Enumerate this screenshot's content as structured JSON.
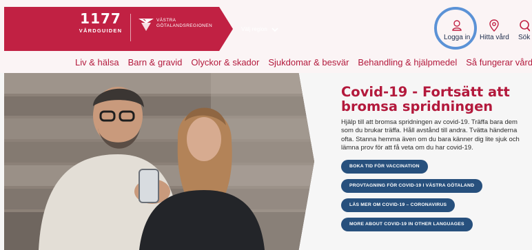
{
  "header": {
    "logo_number": "1177",
    "logo_subtitle": "VÅRDGUIDEN",
    "region_logo_line1": "VÄSTRA",
    "region_logo_line2": "GÖTALANDSREGIONEN",
    "region_select_label": "Välj region",
    "utility": {
      "login_label": "Logga in",
      "find_care_label": "Hitta vård",
      "search_label": "Sök"
    }
  },
  "nav": {
    "items": [
      "Liv & hälsa",
      "Barn & gravid",
      "Olyckor & skador",
      "Sjukdomar & besvär",
      "Behandling & hjälpmedel",
      "Så fungerar vården"
    ]
  },
  "hero": {
    "title": "Covid-19 - Fortsätt att bromsa spridningen",
    "text": "Hjälp till att bromsa spridningen av covid-19. Träffa bara dem som du brukar träffa. Håll avstånd till andra. Tvätta händerna ofta. Stanna hemma även om du bara känner dig lite sjuk och lämna prov för att få veta om du har covid-19.",
    "buttons": [
      "BOKA TID FÖR VACCINATION",
      "PROVTAGNING FÖR COVID-19 I VÄSTRA GÖTALAND",
      "LÄS MER OM COVID-19 – CORONAVIRUS",
      "MORE ABOUT COVID-19 IN OTHER LANGUAGES"
    ]
  },
  "colors": {
    "brand_red": "#c12143",
    "nav_red": "#b3193c",
    "button_blue": "#27507d",
    "highlight_blue": "#5b92d6"
  },
  "icons": {
    "login": "user-icon",
    "find_care": "location-pin-icon",
    "search": "search-icon",
    "region": "chevron-down-icon"
  }
}
